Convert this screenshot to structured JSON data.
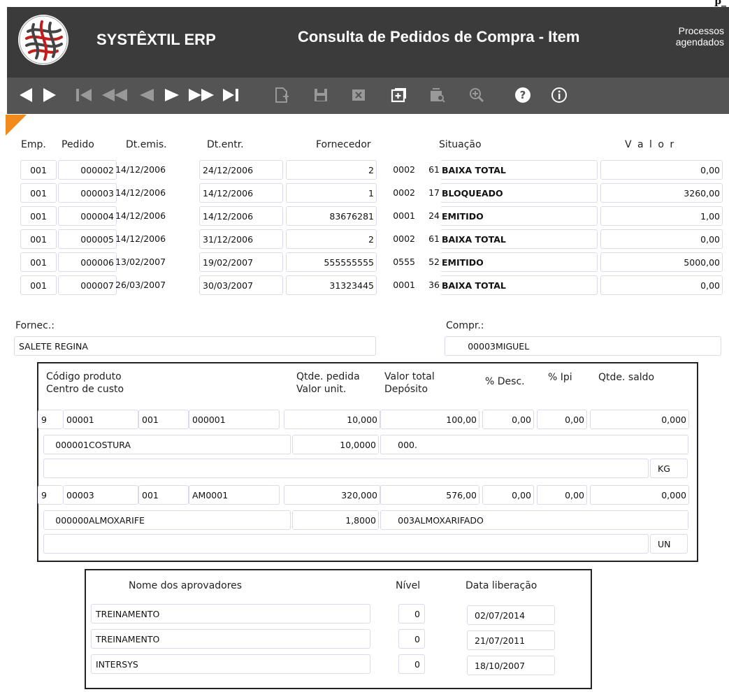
{
  "corner_text": "p_",
  "app_name": "SYSTÊXTIL ERP",
  "screen_title": "Consulta de Pedidos de Compra - Item",
  "processos": {
    "line1": "Processos",
    "line2": "agendados"
  },
  "toolbar_icons": [
    "nav-arrows-icon",
    "first-record-icon",
    "fast-rewind-icon",
    "previous-icon",
    "next-icon",
    "fast-forward-icon",
    "last-record-icon",
    "new-record-icon",
    "save-icon",
    "delete-icon",
    "add-icon",
    "query-icon",
    "zoom-icon",
    "help-icon",
    "info-icon"
  ],
  "orders": {
    "headers": {
      "emp": "Emp.",
      "pedido": "Pedido",
      "dtemis": "Dt.emis.",
      "dtentr": "Dt.entr.",
      "fornecedor": "Fornecedor",
      "situacao": "Situação",
      "valor": "V a l o r"
    },
    "rows": [
      {
        "emp": "001",
        "pedido": "000002",
        "dtemis": "14/12/2006",
        "dtentr": "24/12/2006",
        "forn": "2",
        "forn_sub": "0002",
        "sit_code": "61",
        "sit": "BAIXA TOTAL",
        "valor": "0,00"
      },
      {
        "emp": "001",
        "pedido": "000003",
        "dtemis": "14/12/2006",
        "dtentr": "14/12/2006",
        "forn": "1",
        "forn_sub": "0002",
        "sit_code": "17",
        "sit": "BLOQUEADO",
        "valor": "3260,00"
      },
      {
        "emp": "001",
        "pedido": "000004",
        "dtemis": "14/12/2006",
        "dtentr": "14/12/2006",
        "forn": "83676281",
        "forn_sub": "0001",
        "sit_code": "24",
        "sit": "EMITIDO",
        "valor": "1,00"
      },
      {
        "emp": "001",
        "pedido": "000005",
        "dtemis": "14/12/2006",
        "dtentr": "31/12/2006",
        "forn": "2",
        "forn_sub": "0002",
        "sit_code": "61",
        "sit": "BAIXA TOTAL",
        "valor": "0,00"
      },
      {
        "emp": "001",
        "pedido": "000006",
        "dtemis": "13/02/2007",
        "dtentr": "19/02/2007",
        "forn": "555555555",
        "forn_sub": "0555",
        "sit_code": "52",
        "sit": "EMITIDO",
        "valor": "5000,00"
      },
      {
        "emp": "001",
        "pedido": "000007",
        "dtemis": "26/03/2007",
        "dtentr": "30/03/2007",
        "forn": "31323445",
        "forn_sub": "0001",
        "sit_code": "36",
        "sit": "BAIXA TOTAL",
        "valor": "0,00"
      }
    ]
  },
  "fornec": {
    "label": "Fornec.:",
    "value": "SALETE REGINA"
  },
  "compr": {
    "label": "Compr.:",
    "code": "00003",
    "name": "MIGUEL"
  },
  "items": {
    "headers": {
      "codigo": "Código produto",
      "centro": "Centro de custo",
      "qtde_pedida": "Qtde. pedida",
      "valor_unit": "Valor unit.",
      "valor_total": "Valor total",
      "deposito": "Depósito",
      "desc": "% Desc.",
      "ipi": "% Ipi",
      "saldo": "Qtde. saldo"
    },
    "rows": [
      {
        "nivel": "9",
        "grupo": "00001",
        "sub": "001",
        "item": "000001",
        "qtde": "10,000",
        "total": "100,00",
        "desc": "0,00",
        "ipi": "0,00",
        "saldo": "0,000",
        "cc_code": "000001",
        "cc_name": "COSTURA",
        "unit": "10,0000",
        "dep_code": "000",
        "dep_name": ".",
        "un": "KG"
      },
      {
        "nivel": "9",
        "grupo": "00003",
        "sub": "001",
        "item": "AM0001",
        "qtde": "320,000",
        "total": "576,00",
        "desc": "0,00",
        "ipi": "0,00",
        "saldo": "0,000",
        "cc_code": "000000",
        "cc_name": "ALMOXARIFE",
        "unit": "1,8000",
        "dep_code": "003",
        "dep_name": "ALMOXARIFADO",
        "un": "UN"
      }
    ]
  },
  "approvers": {
    "headers": {
      "nome": "Nome dos aprovadores",
      "nivel": "Nível",
      "data": "Data liberação"
    },
    "rows": [
      {
        "nome": "TREINAMENTO",
        "nivel": "0",
        "data": "02/07/2014"
      },
      {
        "nome": "TREINAMENTO",
        "nivel": "0",
        "data": "21/07/2011"
      },
      {
        "nome": "INTERSYS",
        "nivel": "0",
        "data": "18/10/2007"
      }
    ]
  }
}
